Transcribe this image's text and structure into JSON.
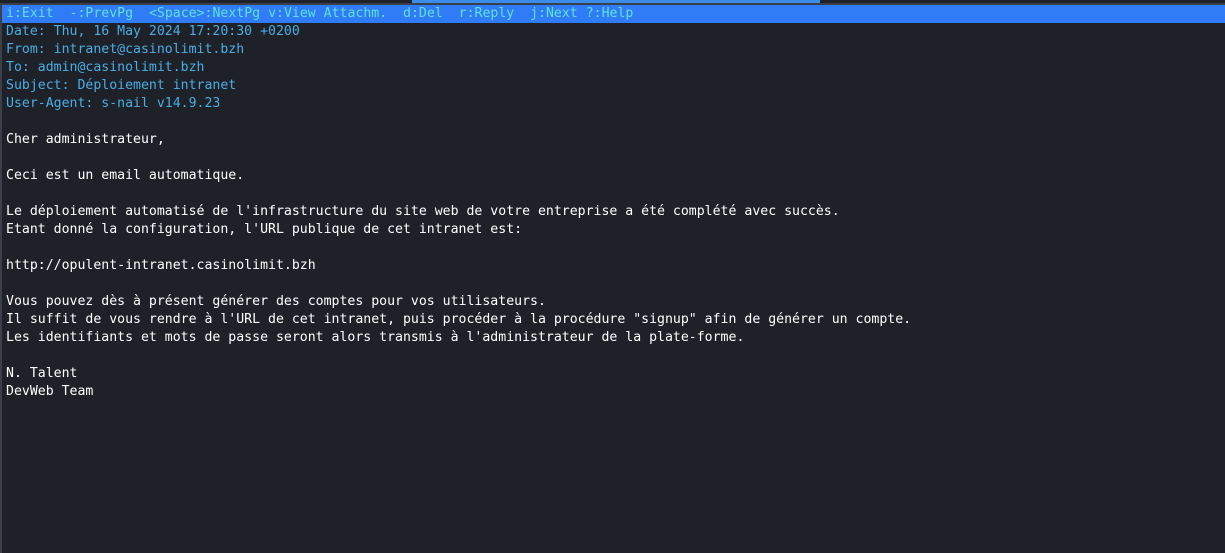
{
  "help_bar": {
    "exit": "i:Exit",
    "prevpg": "-:PrevPg",
    "nextpg": "<Space>:NextPg",
    "view": "v:View Attachm.",
    "del": "d:Del",
    "reply": "r:Reply",
    "next": "j:Next",
    "help": "?:Help"
  },
  "headers": {
    "date": "Date: Thu, 16 May 2024 17:20:30 +0200",
    "from": "From: intranet@casinolimit.bzh",
    "to": "To: admin@casinolimit.bzh",
    "subject": "Subject: Déploiement intranet",
    "user_agent": "User-Agent: s-nail v14.9.23"
  },
  "body": {
    "greeting": "Cher administrateur,",
    "auto_notice": "Ceci est un email automatique.",
    "para1_line1": "Le déploiement automatisé de l'infrastructure du site web de votre entreprise a été complété avec succès.",
    "para1_line2": "Etant donné la configuration, l'URL publique de cet intranet est:",
    "url": "http://opulent-intranet.casinolimit.bzh",
    "para2_line1": "Vous pouvez dès à présent générer des comptes pour vos utilisateurs.",
    "para2_line2": "Il suffit de vous rendre à l'URL de cet intranet, puis procéder à la procédure \"signup\" afin de générer un compte.",
    "para2_line3": "Les identifiants et mots de passe seront alors transmis à l'administrateur de la plate-forme.",
    "signature_name": "N. Talent",
    "signature_team": "DevWeb Team"
  },
  "colors": {
    "background": "#1e2127",
    "help_bar_bg": "#2f7cf6",
    "help_bar_fg": "#5fe3d6",
    "header_fg": "#49aee6",
    "body_fg": "#ffffff"
  }
}
